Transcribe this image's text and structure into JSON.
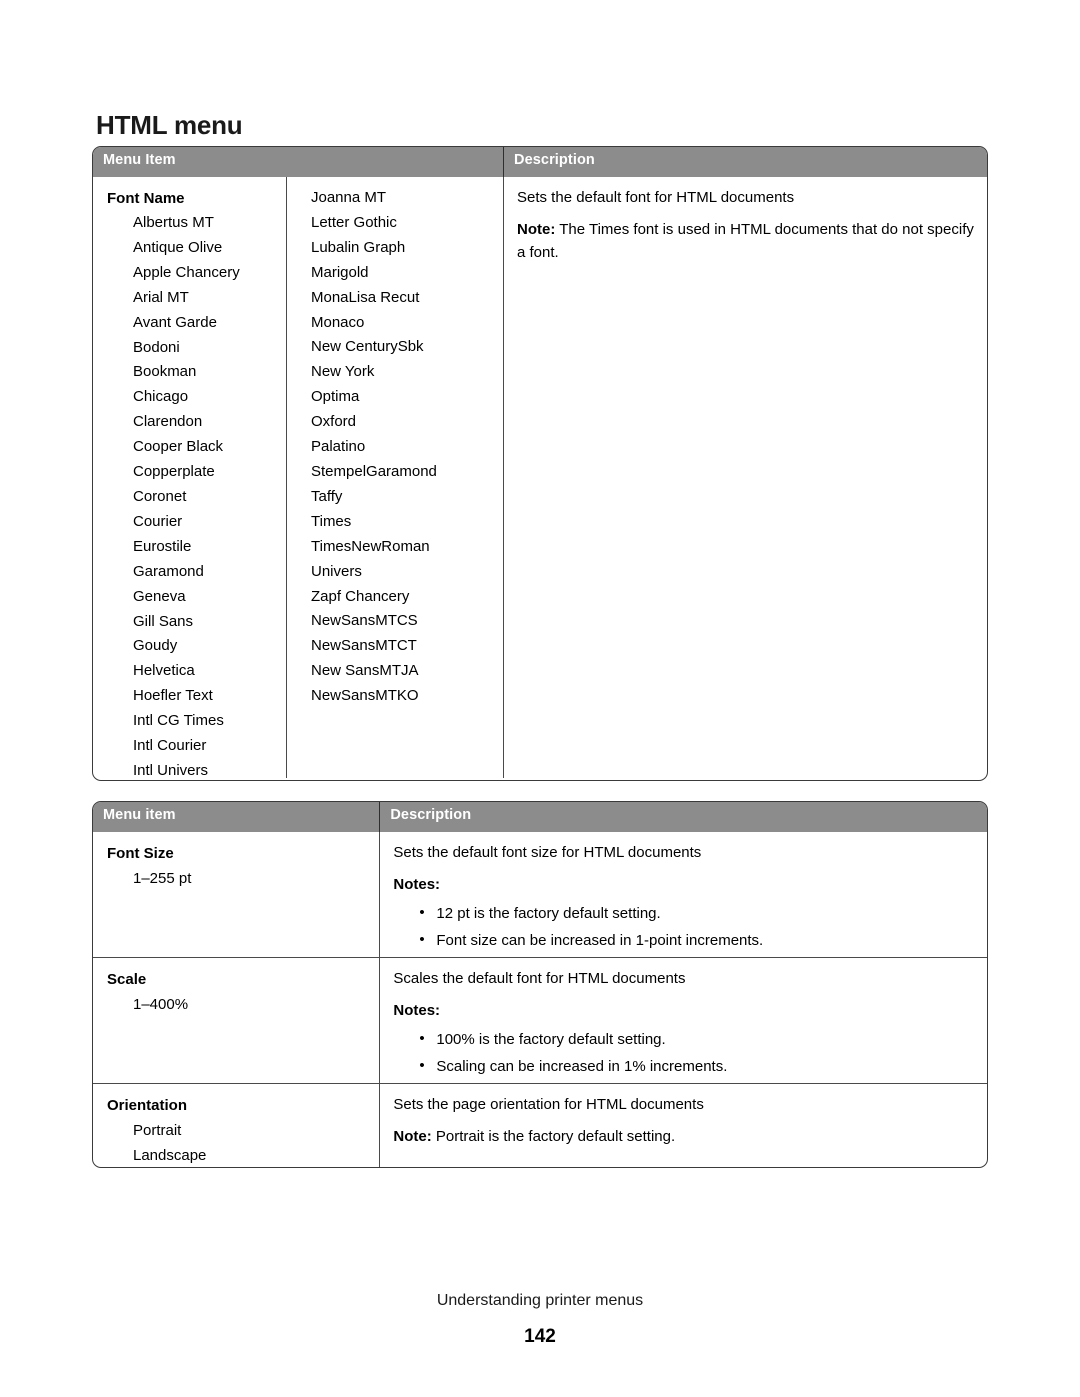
{
  "document": {
    "title": "HTML menu",
    "footer_section": "Understanding printer menus",
    "page_number": "142"
  },
  "theme": {
    "header_background": "#8c8c8c",
    "header_text": "#ffffff",
    "border": "#3a3a3a",
    "body_text": "#000000"
  },
  "tables": [
    {
      "id": "font-name-table",
      "headers": {
        "menu_item": "Menu Item",
        "description": "Description"
      },
      "row": {
        "group_label": "Font Name",
        "fonts_column_1": [
          "Albertus MT",
          "Antique Olive",
          "Apple Chancery",
          "Arial MT",
          "Avant Garde",
          "Bodoni",
          "Bookman",
          "Chicago",
          "Clarendon",
          "Cooper Black",
          "Copperplate",
          "Coronet",
          "Courier",
          "Eurostile",
          "Garamond",
          "Geneva",
          "Gill Sans",
          "Goudy",
          "Helvetica",
          "Hoefler Text",
          "Intl CG Times",
          "Intl Courier",
          "Intl Univers"
        ],
        "fonts_column_2": [
          "Joanna MT",
          "Letter Gothic",
          "Lubalin Graph",
          "Marigold",
          "MonaLisa Recut",
          "Monaco",
          "New CenturySbk",
          "New York",
          "Optima",
          "Oxford",
          "Palatino",
          "StempelGaramond",
          "Taffy",
          "Times",
          "TimesNewRoman",
          "Univers",
          "Zapf Chancery",
          "NewSansMTCS",
          "NewSansMTCT",
          "New SansMTJA",
          "NewSansMTKO"
        ],
        "description_line": "Sets the default font for HTML documents",
        "note_label": "Note:",
        "note_text": " The Times font is used in HTML documents that do not specify a font."
      }
    },
    {
      "id": "html-settings-table",
      "headers": {
        "menu_item": "Menu item",
        "description": "Description"
      },
      "rows": [
        {
          "name": "Font Size",
          "values": [
            "1–255 pt"
          ],
          "description_line": "Sets the default font size for HTML documents",
          "notes_label": "Notes:",
          "notes": [
            "12 pt is the factory default setting.",
            "Font size can be increased in 1-point increments."
          ]
        },
        {
          "name": "Scale",
          "values": [
            "1–400%"
          ],
          "description_line": "Scales the default font for HTML documents",
          "notes_label": "Notes:",
          "notes": [
            "100% is the factory default setting.",
            "Scaling can be increased in 1% increments."
          ]
        },
        {
          "name": "Orientation",
          "values": [
            "Portrait",
            "Landscape"
          ],
          "description_line": "Sets the page orientation for HTML documents",
          "note_label": "Note:",
          "note_text": " Portrait is the factory default setting."
        }
      ]
    }
  ]
}
